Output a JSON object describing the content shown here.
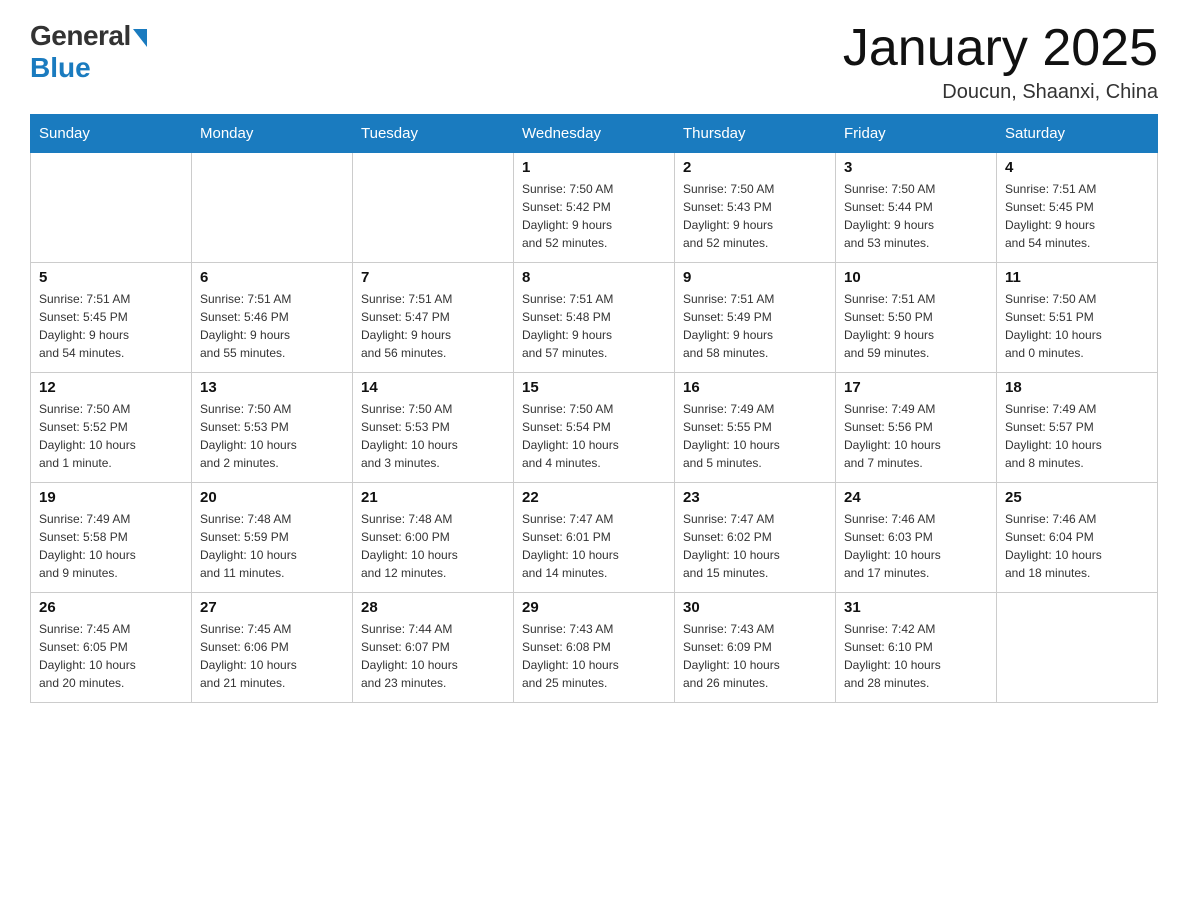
{
  "header": {
    "logo_general": "General",
    "logo_blue": "Blue",
    "title": "January 2025",
    "location": "Doucun, Shaanxi, China"
  },
  "days_of_week": [
    "Sunday",
    "Monday",
    "Tuesday",
    "Wednesday",
    "Thursday",
    "Friday",
    "Saturday"
  ],
  "weeks": [
    [
      {
        "day": "",
        "info": ""
      },
      {
        "day": "",
        "info": ""
      },
      {
        "day": "",
        "info": ""
      },
      {
        "day": "1",
        "info": "Sunrise: 7:50 AM\nSunset: 5:42 PM\nDaylight: 9 hours\nand 52 minutes."
      },
      {
        "day": "2",
        "info": "Sunrise: 7:50 AM\nSunset: 5:43 PM\nDaylight: 9 hours\nand 52 minutes."
      },
      {
        "day": "3",
        "info": "Sunrise: 7:50 AM\nSunset: 5:44 PM\nDaylight: 9 hours\nand 53 minutes."
      },
      {
        "day": "4",
        "info": "Sunrise: 7:51 AM\nSunset: 5:45 PM\nDaylight: 9 hours\nand 54 minutes."
      }
    ],
    [
      {
        "day": "5",
        "info": "Sunrise: 7:51 AM\nSunset: 5:45 PM\nDaylight: 9 hours\nand 54 minutes."
      },
      {
        "day": "6",
        "info": "Sunrise: 7:51 AM\nSunset: 5:46 PM\nDaylight: 9 hours\nand 55 minutes."
      },
      {
        "day": "7",
        "info": "Sunrise: 7:51 AM\nSunset: 5:47 PM\nDaylight: 9 hours\nand 56 minutes."
      },
      {
        "day": "8",
        "info": "Sunrise: 7:51 AM\nSunset: 5:48 PM\nDaylight: 9 hours\nand 57 minutes."
      },
      {
        "day": "9",
        "info": "Sunrise: 7:51 AM\nSunset: 5:49 PM\nDaylight: 9 hours\nand 58 minutes."
      },
      {
        "day": "10",
        "info": "Sunrise: 7:51 AM\nSunset: 5:50 PM\nDaylight: 9 hours\nand 59 minutes."
      },
      {
        "day": "11",
        "info": "Sunrise: 7:50 AM\nSunset: 5:51 PM\nDaylight: 10 hours\nand 0 minutes."
      }
    ],
    [
      {
        "day": "12",
        "info": "Sunrise: 7:50 AM\nSunset: 5:52 PM\nDaylight: 10 hours\nand 1 minute."
      },
      {
        "day": "13",
        "info": "Sunrise: 7:50 AM\nSunset: 5:53 PM\nDaylight: 10 hours\nand 2 minutes."
      },
      {
        "day": "14",
        "info": "Sunrise: 7:50 AM\nSunset: 5:53 PM\nDaylight: 10 hours\nand 3 minutes."
      },
      {
        "day": "15",
        "info": "Sunrise: 7:50 AM\nSunset: 5:54 PM\nDaylight: 10 hours\nand 4 minutes."
      },
      {
        "day": "16",
        "info": "Sunrise: 7:49 AM\nSunset: 5:55 PM\nDaylight: 10 hours\nand 5 minutes."
      },
      {
        "day": "17",
        "info": "Sunrise: 7:49 AM\nSunset: 5:56 PM\nDaylight: 10 hours\nand 7 minutes."
      },
      {
        "day": "18",
        "info": "Sunrise: 7:49 AM\nSunset: 5:57 PM\nDaylight: 10 hours\nand 8 minutes."
      }
    ],
    [
      {
        "day": "19",
        "info": "Sunrise: 7:49 AM\nSunset: 5:58 PM\nDaylight: 10 hours\nand 9 minutes."
      },
      {
        "day": "20",
        "info": "Sunrise: 7:48 AM\nSunset: 5:59 PM\nDaylight: 10 hours\nand 11 minutes."
      },
      {
        "day": "21",
        "info": "Sunrise: 7:48 AM\nSunset: 6:00 PM\nDaylight: 10 hours\nand 12 minutes."
      },
      {
        "day": "22",
        "info": "Sunrise: 7:47 AM\nSunset: 6:01 PM\nDaylight: 10 hours\nand 14 minutes."
      },
      {
        "day": "23",
        "info": "Sunrise: 7:47 AM\nSunset: 6:02 PM\nDaylight: 10 hours\nand 15 minutes."
      },
      {
        "day": "24",
        "info": "Sunrise: 7:46 AM\nSunset: 6:03 PM\nDaylight: 10 hours\nand 17 minutes."
      },
      {
        "day": "25",
        "info": "Sunrise: 7:46 AM\nSunset: 6:04 PM\nDaylight: 10 hours\nand 18 minutes."
      }
    ],
    [
      {
        "day": "26",
        "info": "Sunrise: 7:45 AM\nSunset: 6:05 PM\nDaylight: 10 hours\nand 20 minutes."
      },
      {
        "day": "27",
        "info": "Sunrise: 7:45 AM\nSunset: 6:06 PM\nDaylight: 10 hours\nand 21 minutes."
      },
      {
        "day": "28",
        "info": "Sunrise: 7:44 AM\nSunset: 6:07 PM\nDaylight: 10 hours\nand 23 minutes."
      },
      {
        "day": "29",
        "info": "Sunrise: 7:43 AM\nSunset: 6:08 PM\nDaylight: 10 hours\nand 25 minutes."
      },
      {
        "day": "30",
        "info": "Sunrise: 7:43 AM\nSunset: 6:09 PM\nDaylight: 10 hours\nand 26 minutes."
      },
      {
        "day": "31",
        "info": "Sunrise: 7:42 AM\nSunset: 6:10 PM\nDaylight: 10 hours\nand 28 minutes."
      },
      {
        "day": "",
        "info": ""
      }
    ]
  ]
}
